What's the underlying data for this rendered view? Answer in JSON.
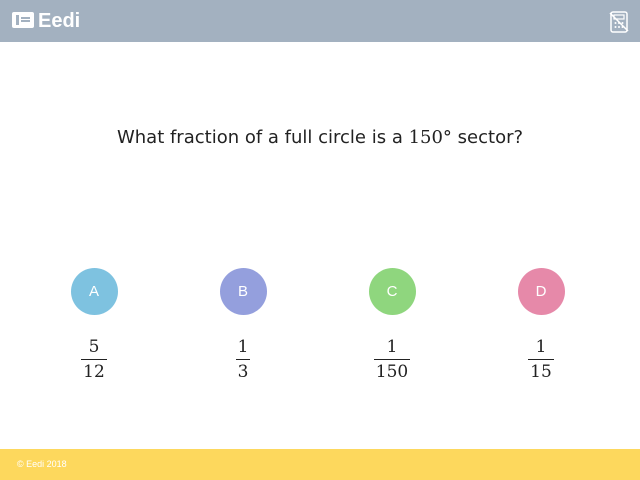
{
  "header": {
    "logo_text": "Eedi",
    "calculator_icon": "calculator-disabled-icon"
  },
  "question": {
    "parts": [
      "What fraction of a full circle is a ",
      "150°",
      " sector?"
    ]
  },
  "options": [
    {
      "letter": "A",
      "color": "#7ec2e0",
      "numerator": "5",
      "denominator": "12"
    },
    {
      "letter": "B",
      "color": "#949fdd",
      "numerator": "1",
      "denominator": "3"
    },
    {
      "letter": "C",
      "color": "#8fd67e",
      "numerator": "1",
      "denominator": "150"
    },
    {
      "letter": "D",
      "color": "#e689a9",
      "numerator": "1",
      "denominator": "15"
    }
  ],
  "footer": {
    "copyright": "© Eedi 2018"
  },
  "colors": {
    "header_bg": "#a3b1c0",
    "footer_bg": "#fdd85d"
  }
}
